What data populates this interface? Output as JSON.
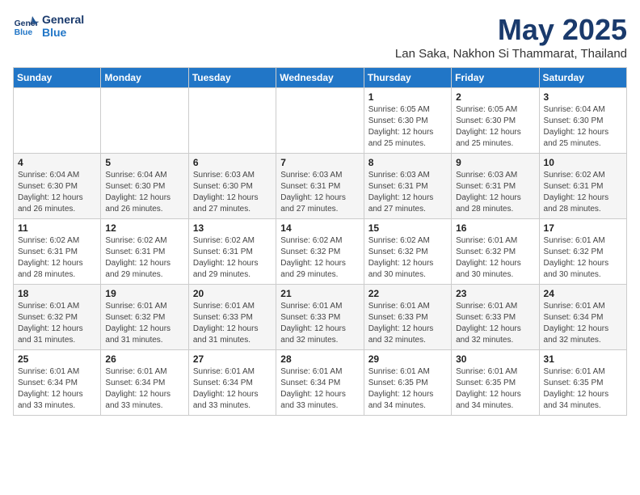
{
  "logo": {
    "line1": "General",
    "line2": "Blue"
  },
  "title": "May 2025",
  "location": "Lan Saka, Nakhon Si Thammarat, Thailand",
  "days_of_week": [
    "Sunday",
    "Monday",
    "Tuesday",
    "Wednesday",
    "Thursday",
    "Friday",
    "Saturday"
  ],
  "weeks": [
    [
      {
        "day": "",
        "info": ""
      },
      {
        "day": "",
        "info": ""
      },
      {
        "day": "",
        "info": ""
      },
      {
        "day": "",
        "info": ""
      },
      {
        "day": "1",
        "info": "Sunrise: 6:05 AM\nSunset: 6:30 PM\nDaylight: 12 hours and 25 minutes."
      },
      {
        "day": "2",
        "info": "Sunrise: 6:05 AM\nSunset: 6:30 PM\nDaylight: 12 hours and 25 minutes."
      },
      {
        "day": "3",
        "info": "Sunrise: 6:04 AM\nSunset: 6:30 PM\nDaylight: 12 hours and 25 minutes."
      }
    ],
    [
      {
        "day": "4",
        "info": "Sunrise: 6:04 AM\nSunset: 6:30 PM\nDaylight: 12 hours and 26 minutes."
      },
      {
        "day": "5",
        "info": "Sunrise: 6:04 AM\nSunset: 6:30 PM\nDaylight: 12 hours and 26 minutes."
      },
      {
        "day": "6",
        "info": "Sunrise: 6:03 AM\nSunset: 6:30 PM\nDaylight: 12 hours and 27 minutes."
      },
      {
        "day": "7",
        "info": "Sunrise: 6:03 AM\nSunset: 6:31 PM\nDaylight: 12 hours and 27 minutes."
      },
      {
        "day": "8",
        "info": "Sunrise: 6:03 AM\nSunset: 6:31 PM\nDaylight: 12 hours and 27 minutes."
      },
      {
        "day": "9",
        "info": "Sunrise: 6:03 AM\nSunset: 6:31 PM\nDaylight: 12 hours and 28 minutes."
      },
      {
        "day": "10",
        "info": "Sunrise: 6:02 AM\nSunset: 6:31 PM\nDaylight: 12 hours and 28 minutes."
      }
    ],
    [
      {
        "day": "11",
        "info": "Sunrise: 6:02 AM\nSunset: 6:31 PM\nDaylight: 12 hours and 28 minutes."
      },
      {
        "day": "12",
        "info": "Sunrise: 6:02 AM\nSunset: 6:31 PM\nDaylight: 12 hours and 29 minutes."
      },
      {
        "day": "13",
        "info": "Sunrise: 6:02 AM\nSunset: 6:31 PM\nDaylight: 12 hours and 29 minutes."
      },
      {
        "day": "14",
        "info": "Sunrise: 6:02 AM\nSunset: 6:32 PM\nDaylight: 12 hours and 29 minutes."
      },
      {
        "day": "15",
        "info": "Sunrise: 6:02 AM\nSunset: 6:32 PM\nDaylight: 12 hours and 30 minutes."
      },
      {
        "day": "16",
        "info": "Sunrise: 6:01 AM\nSunset: 6:32 PM\nDaylight: 12 hours and 30 minutes."
      },
      {
        "day": "17",
        "info": "Sunrise: 6:01 AM\nSunset: 6:32 PM\nDaylight: 12 hours and 30 minutes."
      }
    ],
    [
      {
        "day": "18",
        "info": "Sunrise: 6:01 AM\nSunset: 6:32 PM\nDaylight: 12 hours and 31 minutes."
      },
      {
        "day": "19",
        "info": "Sunrise: 6:01 AM\nSunset: 6:32 PM\nDaylight: 12 hours and 31 minutes."
      },
      {
        "day": "20",
        "info": "Sunrise: 6:01 AM\nSunset: 6:33 PM\nDaylight: 12 hours and 31 minutes."
      },
      {
        "day": "21",
        "info": "Sunrise: 6:01 AM\nSunset: 6:33 PM\nDaylight: 12 hours and 32 minutes."
      },
      {
        "day": "22",
        "info": "Sunrise: 6:01 AM\nSunset: 6:33 PM\nDaylight: 12 hours and 32 minutes."
      },
      {
        "day": "23",
        "info": "Sunrise: 6:01 AM\nSunset: 6:33 PM\nDaylight: 12 hours and 32 minutes."
      },
      {
        "day": "24",
        "info": "Sunrise: 6:01 AM\nSunset: 6:34 PM\nDaylight: 12 hours and 32 minutes."
      }
    ],
    [
      {
        "day": "25",
        "info": "Sunrise: 6:01 AM\nSunset: 6:34 PM\nDaylight: 12 hours and 33 minutes."
      },
      {
        "day": "26",
        "info": "Sunrise: 6:01 AM\nSunset: 6:34 PM\nDaylight: 12 hours and 33 minutes."
      },
      {
        "day": "27",
        "info": "Sunrise: 6:01 AM\nSunset: 6:34 PM\nDaylight: 12 hours and 33 minutes."
      },
      {
        "day": "28",
        "info": "Sunrise: 6:01 AM\nSunset: 6:34 PM\nDaylight: 12 hours and 33 minutes."
      },
      {
        "day": "29",
        "info": "Sunrise: 6:01 AM\nSunset: 6:35 PM\nDaylight: 12 hours and 34 minutes."
      },
      {
        "day": "30",
        "info": "Sunrise: 6:01 AM\nSunset: 6:35 PM\nDaylight: 12 hours and 34 minutes."
      },
      {
        "day": "31",
        "info": "Sunrise: 6:01 AM\nSunset: 6:35 PM\nDaylight: 12 hours and 34 minutes."
      }
    ]
  ]
}
